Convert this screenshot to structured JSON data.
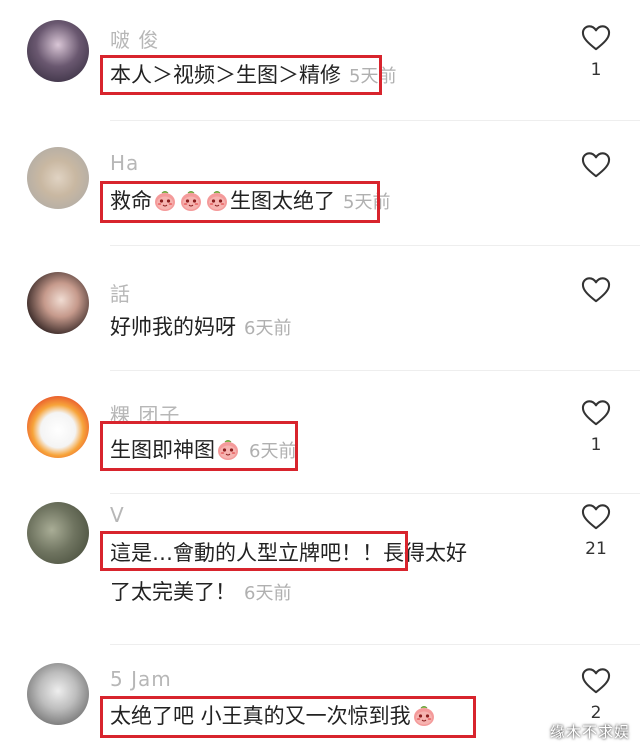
{
  "comments": [
    {
      "username": "啵      俊",
      "text": "本人＞视频＞生图＞精修",
      "time": "5天前",
      "likes": "1"
    },
    {
      "username": "Ha",
      "text_prefix": "救命",
      "text_suffix": "生图太绝了",
      "time": "5天前",
      "likes": ""
    },
    {
      "username": "話",
      "text": "好帅我的妈呀",
      "time": "6天前",
      "likes": ""
    },
    {
      "username": "粿      团子",
      "text": "生图即神图",
      "time": "6天前",
      "likes": "1"
    },
    {
      "username": "V",
      "text_line1": "這是…會動的人型立牌吧！！長得太好",
      "text_line2": "了太完美了！",
      "time": "6天前",
      "likes": "21"
    },
    {
      "username": "5      Jam",
      "text": "太绝了吧 小王真的又一次惊到我",
      "time": "",
      "likes": "2"
    }
  ],
  "watermark": "缘木不求娱",
  "icons": {
    "like": "heart-outline-icon",
    "emoji": "peach-emoji-icon"
  },
  "colors": {
    "highlight": "#d8242d",
    "username": "#b7b7b7",
    "time": "#b0b0b0"
  }
}
